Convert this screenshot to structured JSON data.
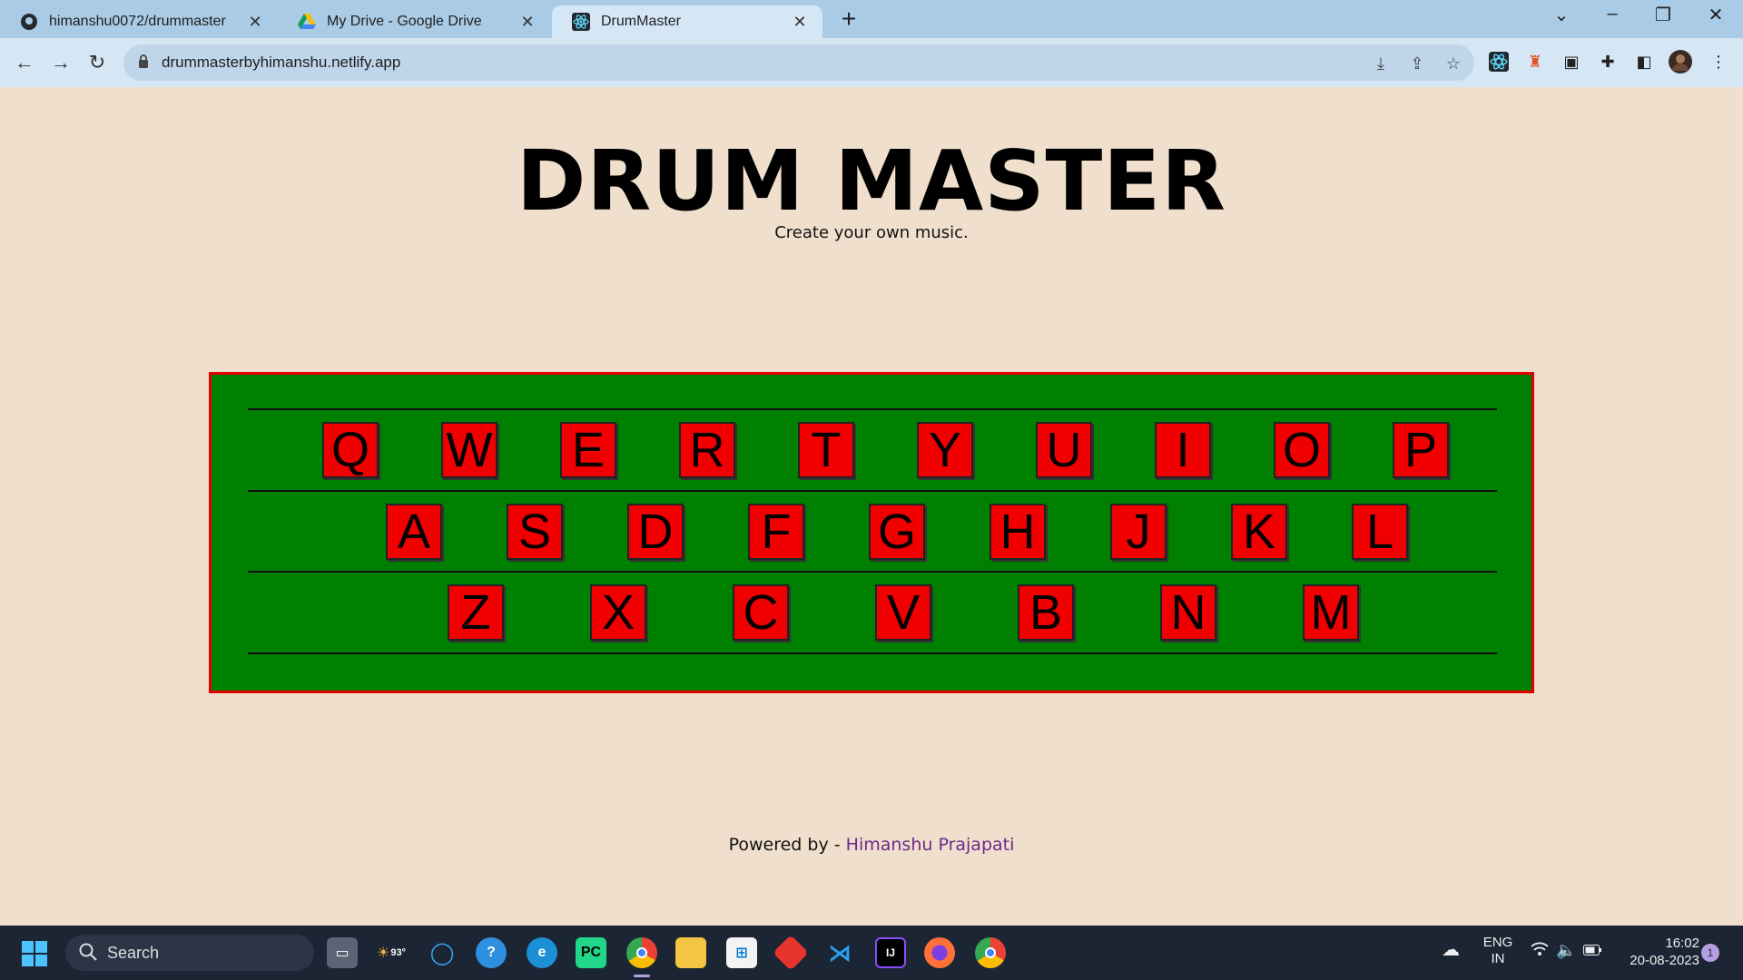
{
  "browser": {
    "tabs": [
      {
        "title": "himanshu0072/drummaster",
        "icon": "github-icon"
      },
      {
        "title": "My Drive - Google Drive",
        "icon": "google-drive-icon"
      },
      {
        "title": "DrumMaster",
        "icon": "react-icon",
        "active": true
      }
    ],
    "url": "drummasterbyhimanshu.netlify.app"
  },
  "page": {
    "title": "DRUM MASTER",
    "subtitle": "Create your own music.",
    "board_colors": {
      "background": "#008000",
      "border": "#e00000",
      "key": "#f00000"
    },
    "rows": [
      [
        "Q",
        "W",
        "E",
        "R",
        "T",
        "Y",
        "U",
        "I",
        "O",
        "P"
      ],
      [
        "A",
        "S",
        "D",
        "F",
        "G",
        "H",
        "J",
        "K",
        "L"
      ],
      [
        "Z",
        "X",
        "C",
        "V",
        "B",
        "N",
        "M"
      ]
    ],
    "footer_prefix": "Powered by -",
    "footer_author": "Himanshu Prajapati"
  },
  "taskbar": {
    "search_label": "Search",
    "weather": "93°",
    "language": "ENG",
    "region": "IN",
    "time": "16:02",
    "date": "20-08-2023",
    "notification_count": "1"
  }
}
